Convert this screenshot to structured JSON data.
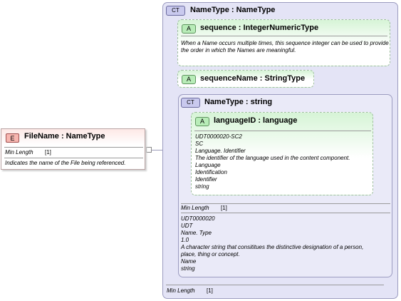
{
  "element": {
    "badge": "E",
    "title": "FileName : NameType",
    "facet_label": "Min Length",
    "facet_value": "[1]",
    "doc": "Indicates the name of the File being referenced."
  },
  "outer_type": {
    "badge": "CT",
    "title": "NameType : NameType",
    "facet_label": "Min Length",
    "facet_value": "[1]"
  },
  "sequence_attr": {
    "badge": "A",
    "title": "sequence : IntegerNumericType",
    "doc_lines": [
      "When a Name occurs multiple times, this sequence integer can be used to provide",
      "the order in which the Names are meaningful."
    ]
  },
  "sequence_name_attr": {
    "badge": "A",
    "title": "sequenceName : StringType"
  },
  "inner_type": {
    "badge": "CT",
    "title": "NameType : string",
    "facet_label": "Min Length",
    "facet_value": "[1]",
    "doc_lines": [
      "UDT0000020",
      "UDT",
      "Name. Type",
      "1.0",
      "A character string that consititues the distinctive designation of a person,",
      "place, thing or concept.",
      "Name",
      "string"
    ]
  },
  "language_attr": {
    "badge": "A",
    "title": "languageID : language",
    "doc_lines": [
      "UDT0000020-SC2",
      "SC",
      "Language. Identifier",
      "The identifier of the language used in the content component.",
      "Language",
      "Identification",
      "Identifier",
      "string"
    ]
  },
  "colors": {
    "element_badge": "#f7b6b0",
    "complex_type_bg": "#e4e4f6",
    "attribute_badge": "#b8ecb8"
  }
}
